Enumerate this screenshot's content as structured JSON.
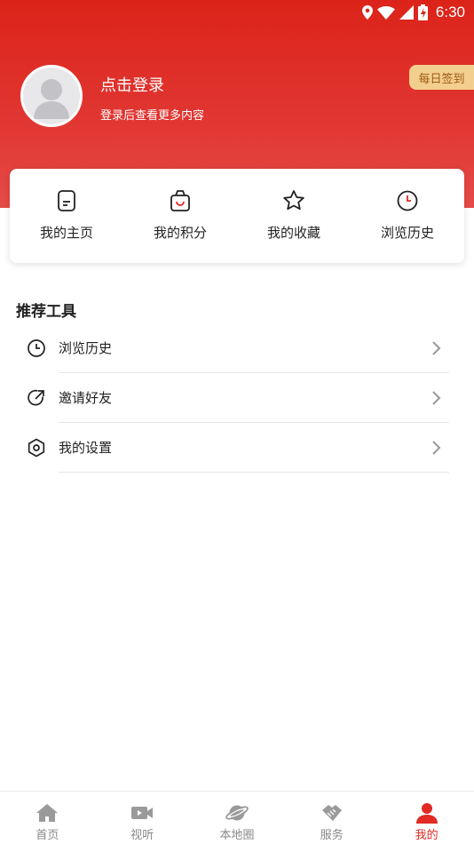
{
  "status_bar": {
    "time": "6:30"
  },
  "profile": {
    "login_title": "点击登录",
    "login_subtitle": "登录后查看更多内容",
    "daily_signin": "每日签到"
  },
  "quick_menu": [
    {
      "label": "我的主页",
      "icon": "homepage-icon"
    },
    {
      "label": "我的积分",
      "icon": "points-bag-icon"
    },
    {
      "label": "我的收藏",
      "icon": "star-icon"
    },
    {
      "label": "浏览历史",
      "icon": "clock-icon"
    }
  ],
  "tools": {
    "title": "推荐工具",
    "items": [
      {
        "label": "浏览历史",
        "icon": "clock-icon"
      },
      {
        "label": "邀请好友",
        "icon": "share-icon"
      },
      {
        "label": "我的设置",
        "icon": "settings-icon"
      }
    ]
  },
  "tabbar": {
    "items": [
      {
        "label": "首页",
        "icon": "home-icon"
      },
      {
        "label": "视听",
        "icon": "video-icon"
      },
      {
        "label": "本地圈",
        "icon": "planet-icon"
      },
      {
        "label": "服务",
        "icon": "handshake-icon"
      },
      {
        "label": "我的",
        "icon": "profile-icon",
        "active": true
      }
    ]
  },
  "colors": {
    "header_red": "#dc2319",
    "accent": "#e02a23",
    "signin_bg": "#f3cf8f"
  }
}
